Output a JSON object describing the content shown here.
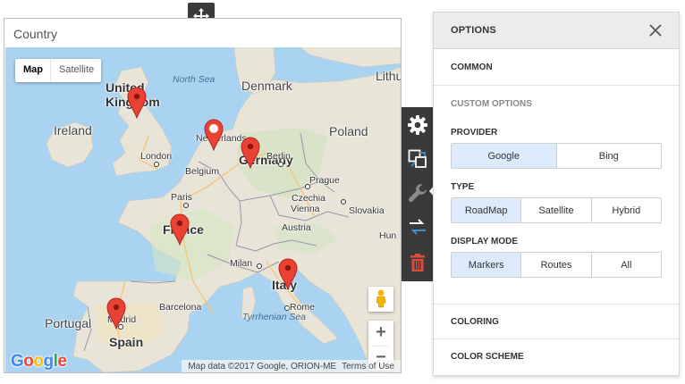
{
  "map": {
    "caption": "Country",
    "map_type": {
      "map": "Map",
      "satellite": "Satellite"
    },
    "labels": {
      "north_sea": "North Sea",
      "tyrrhenian_sea": "Tyrrhenian Sea",
      "united_kingdom_1": "United",
      "united_kingdom_2": "Kingdom",
      "ireland": "Ireland",
      "denmark": "Denmark",
      "netherlands": "Netherlands",
      "germany": "Germany",
      "poland": "Poland",
      "lithuania": "Lithu",
      "belgium": "Belgium",
      "france": "France",
      "czechia": "Czechia",
      "slovakia": "Slovakia",
      "austria": "Austria",
      "hungary": "Hun",
      "italy": "Italy",
      "spain": "Spain",
      "portugal": "Portugal",
      "london": "London",
      "berlin": "Berlin",
      "prague": "Prague",
      "vienna": "Vienna",
      "paris": "Paris",
      "milan": "Milan",
      "rome": "Rome",
      "barcelona": "Barcelona",
      "madrid": "Madrid"
    },
    "zoom_in": "+",
    "zoom_out": "−",
    "google_logo": {
      "g": "G",
      "o1": "o",
      "o2": "o",
      "g2": "g",
      "l": "l",
      "e": "e"
    },
    "attribution": {
      "data": "Map data ©2017 Google, ORION-ME",
      "terms": "Terms of Use"
    },
    "colors": {
      "land": "#e8e4d7",
      "water": "#a9d3f0",
      "pin": "#e94235"
    }
  },
  "options": {
    "title": "OPTIONS",
    "common": "COMMON",
    "custom_options": "CUSTOM OPTIONS",
    "provider": {
      "label": "PROVIDER",
      "options": [
        "Google",
        "Bing"
      ],
      "selected": "Google"
    },
    "type": {
      "label": "TYPE",
      "options": [
        "RoadMap",
        "Satellite",
        "Hybrid"
      ],
      "selected": "RoadMap"
    },
    "display_mode": {
      "label": "DISPLAY MODE",
      "options": [
        "Markers",
        "Routes",
        "All"
      ],
      "selected": "Markers"
    },
    "coloring": "COLORING",
    "color_scheme": "COLOR SCHEME",
    "accent_selected": "#dcebfb"
  },
  "toolbar": {
    "icons": [
      "gear-icon",
      "interactivity-icon",
      "wrench-icon",
      "convert-icon",
      "trash-icon"
    ],
    "colors": {
      "bg": "#3a3a3a",
      "icon": "#ffffff",
      "accent": "#3d8fd6",
      "delete": "#e14b3b"
    }
  }
}
